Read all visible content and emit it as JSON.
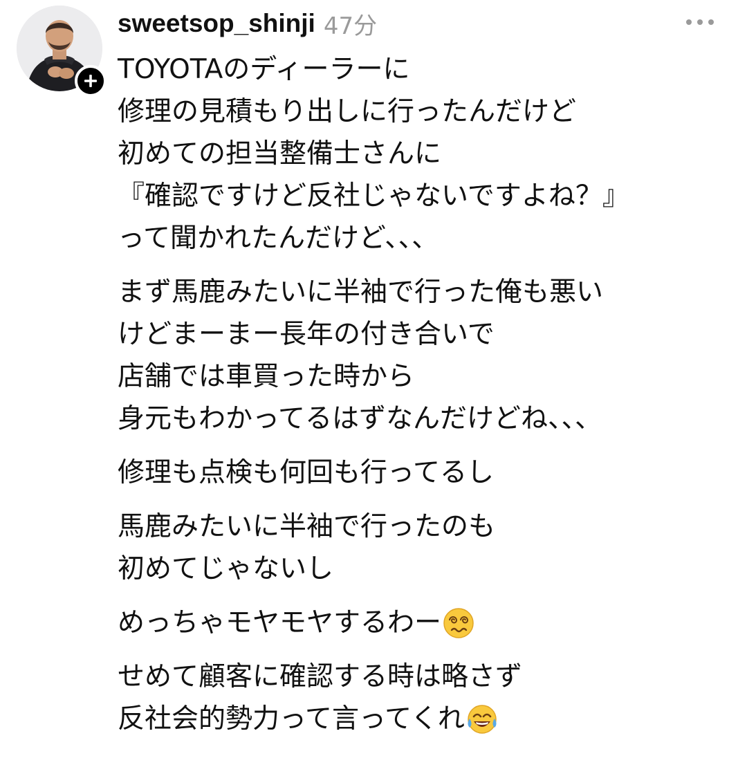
{
  "post": {
    "username": "sweetsop_shinji",
    "timestamp": "47分",
    "icons": {
      "avatar": "profile-photo",
      "follow": "plus-icon",
      "more": "more-horizontal-icon"
    },
    "paragraphs": [
      {
        "lines": [
          {
            "text": "TOYOTAのディーラーに"
          },
          {
            "text": "修理の見積もり出しに行ったんだけど"
          },
          {
            "text": "初めての担当整備士さんに"
          },
          {
            "text": "『確認ですけど反社じゃないですよね？』"
          },
          {
            "text": "って聞かれたんだけど、、、"
          }
        ]
      },
      {
        "lines": [
          {
            "text": "まず馬鹿みたいに半袖で行った俺も悪い"
          },
          {
            "text": "けどまーまー長年の付き合いで"
          },
          {
            "text": "店舗では車買った時から"
          },
          {
            "text": "身元もわかってるはずなんだけどね、、、"
          }
        ]
      },
      {
        "lines": [
          {
            "text": "修理も点検も何回も行ってるし"
          }
        ]
      },
      {
        "lines": [
          {
            "text": "馬鹿みたいに半袖で行ったのも"
          },
          {
            "text": "初めてじゃないし"
          }
        ]
      },
      {
        "lines": [
          {
            "text": "めっちゃモヤモヤするわー",
            "emoji": "dizzy-face-emoji"
          }
        ]
      },
      {
        "lines": [
          {
            "text": "せめて顧客に確認する時は略さず"
          },
          {
            "text": "反社会的勢力って言ってくれ",
            "emoji": "tears-of-joy-emoji"
          }
        ]
      }
    ]
  }
}
